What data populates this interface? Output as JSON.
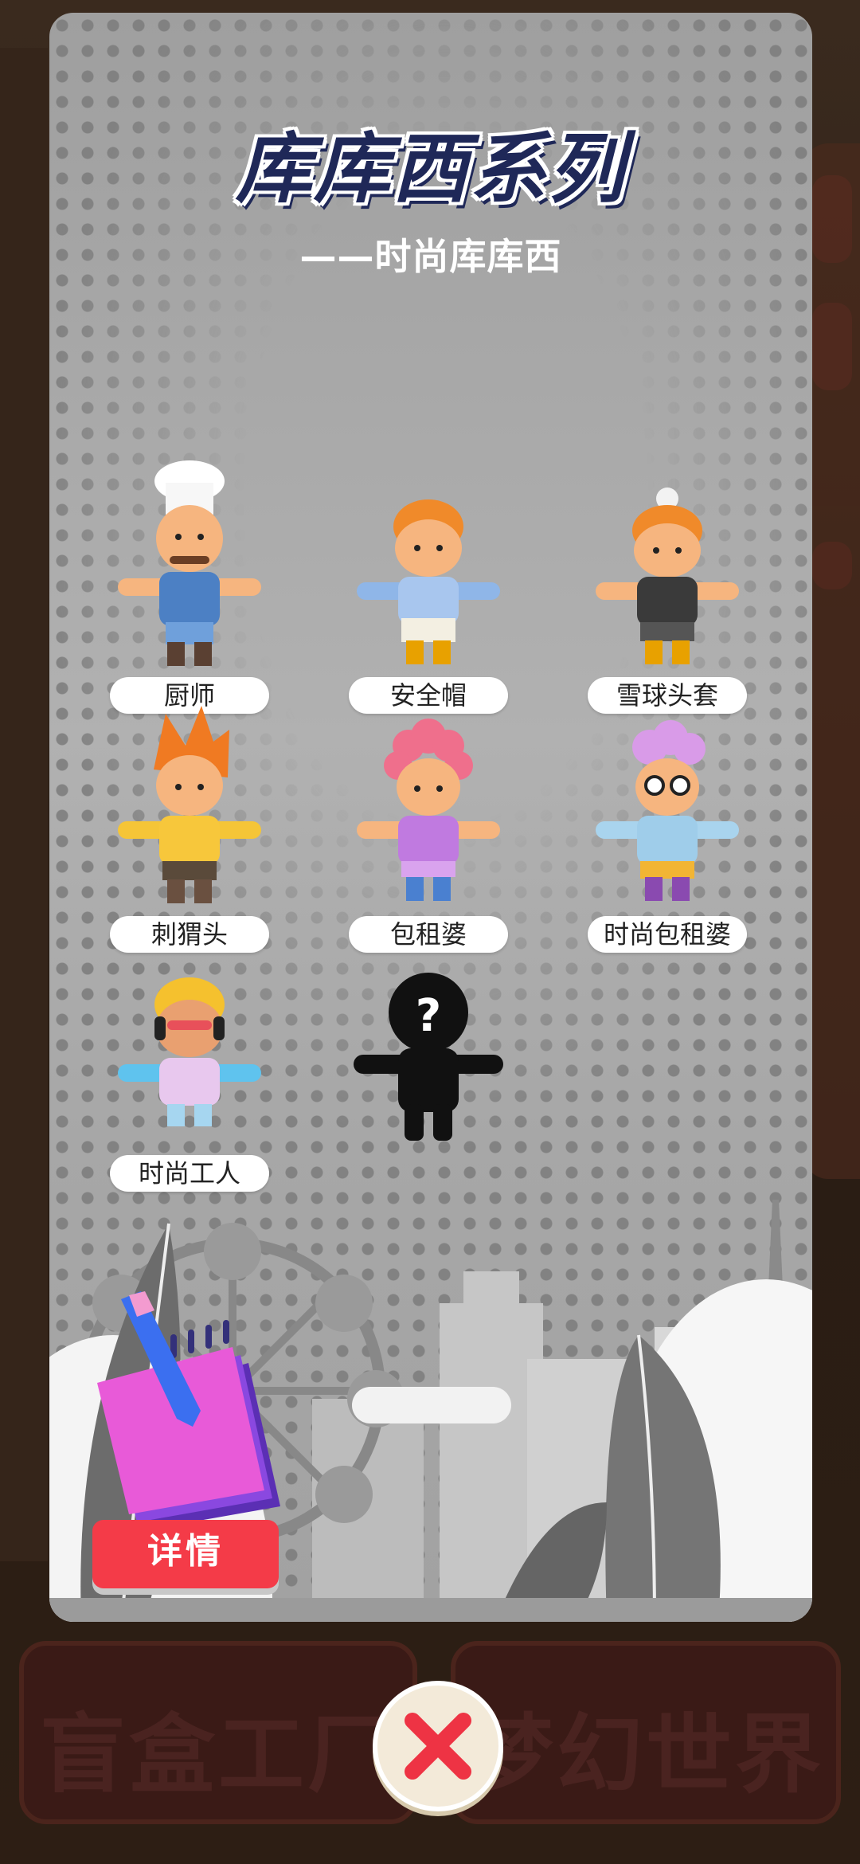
{
  "background": {
    "left_button_label": "盲盒工厂",
    "right_button_label": "梦幻世界"
  },
  "modal": {
    "title": "库库西系列",
    "subtitle": "——时尚库库西",
    "detail_button": "详情",
    "items": [
      {
        "label": "厨师",
        "icon": "chef-figure"
      },
      {
        "label": "安全帽",
        "icon": "hard-hat-figure"
      },
      {
        "label": "雪球头套",
        "icon": "beanie-figure"
      },
      {
        "label": "刺猬头",
        "icon": "spiky-hair-figure"
      },
      {
        "label": "包租婆",
        "icon": "curly-hair-figure"
      },
      {
        "label": "时尚包租婆",
        "icon": "sunglasses-granny-figure"
      },
      {
        "label": "时尚工人",
        "icon": "headphones-worker-figure"
      },
      {
        "label": "",
        "icon": "locked-mystery-figure"
      }
    ]
  },
  "close_icon": "close-x-icon",
  "colors": {
    "title": "#1f2858",
    "detail_button": "#f43b48",
    "close_x": "#ee3344"
  }
}
